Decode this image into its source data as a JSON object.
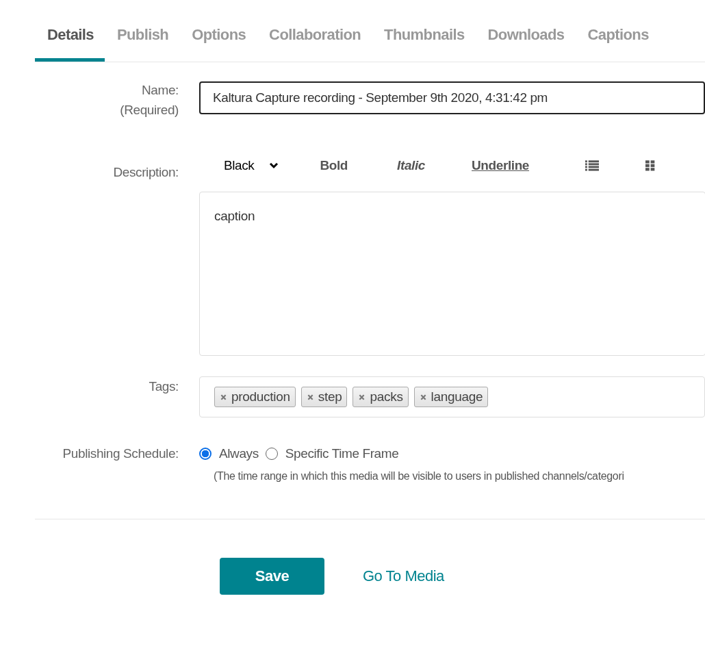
{
  "tabs": [
    {
      "label": "Details",
      "selected": true
    },
    {
      "label": "Publish",
      "selected": false
    },
    {
      "label": "Options",
      "selected": false
    },
    {
      "label": "Collaboration",
      "selected": false
    },
    {
      "label": "Thumbnails",
      "selected": false
    },
    {
      "label": "Downloads",
      "selected": false
    },
    {
      "label": "Captions",
      "selected": false
    }
  ],
  "name": {
    "label": "Name:",
    "note": "(Required)",
    "value": "Kaltura Capture recording - September 9th 2020, 4:31:42 pm"
  },
  "description": {
    "label": "Description:",
    "toolbar": [
      {
        "kind": "dropdown",
        "label": "Black"
      },
      {
        "kind": "bold",
        "label": "Bold"
      },
      {
        "kind": "italic",
        "label": "Italic"
      },
      {
        "kind": "underline",
        "label": "Underline"
      },
      {
        "kind": "list"
      },
      {
        "kind": "grid"
      }
    ],
    "value": "caption"
  },
  "tags": {
    "label": "Tags:",
    "items": [
      "production",
      "step",
      "packs",
      "language"
    ]
  },
  "schedule": {
    "label": "Publishing Schedule:",
    "options": [
      {
        "label": "Always",
        "selected": true
      },
      {
        "label": "Specific Time Frame",
        "selected": false
      }
    ],
    "hint": "(The time range in which this media will be visible to users in published channels/categori"
  },
  "actions": {
    "save": "Save",
    "link": "Go To Media"
  }
}
